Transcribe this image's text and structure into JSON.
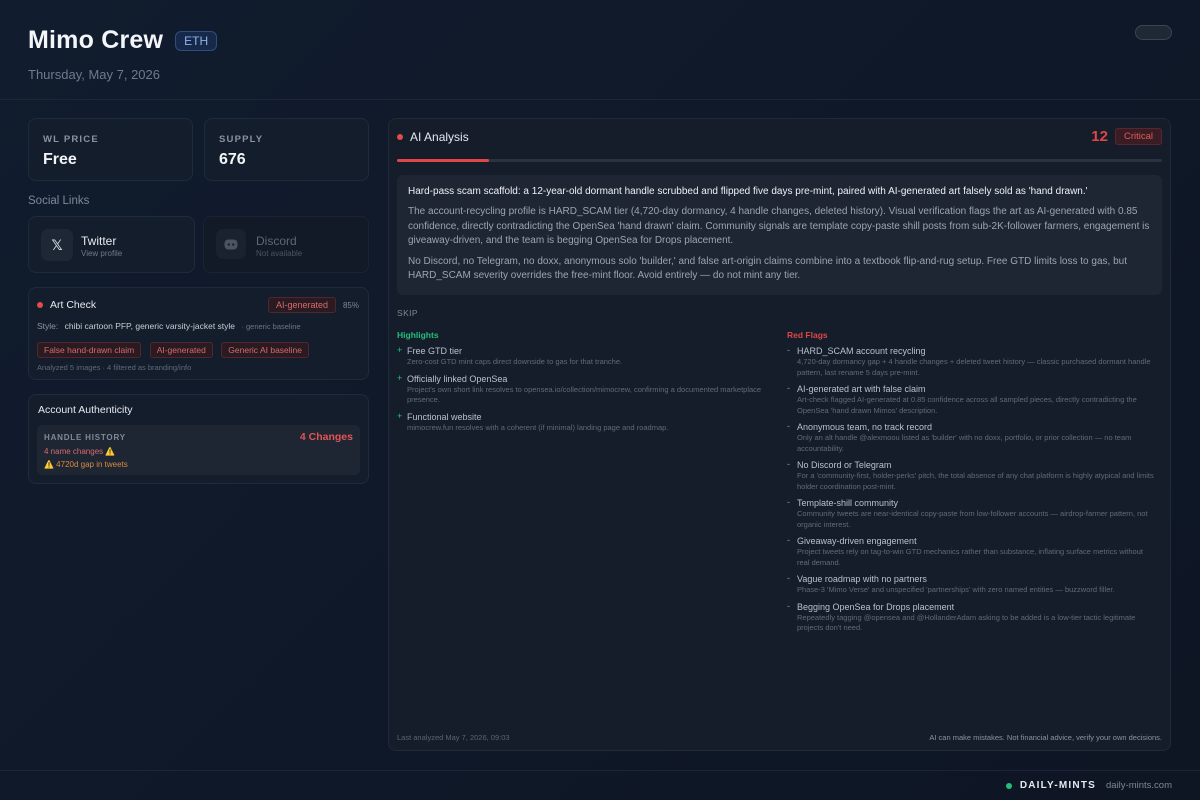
{
  "header": {
    "title": "Mimo Crew",
    "chain": "ETH",
    "date": "Thursday, May 7, 2026"
  },
  "stats": {
    "wl_price": {
      "label": "WL PRICE",
      "value": "Free"
    },
    "supply": {
      "label": "SUPPLY",
      "value": "676"
    }
  },
  "social": {
    "section_label": "Social Links",
    "twitter": {
      "name": "Twitter",
      "sub": "View profile",
      "icon": "x-logo-icon"
    },
    "discord": {
      "name": "Discord",
      "sub": "Not available",
      "icon": "discord-logo-icon"
    }
  },
  "art_check": {
    "title": "Art Check",
    "verdict": "AI-generated",
    "confidence": "85%",
    "style_label": "Style:",
    "style_value": "chibi cartoon PFP, generic varsity-jacket style",
    "style_note": "· generic baseline",
    "tags": [
      "False hand-drawn claim",
      "AI-generated",
      "Generic AI baseline"
    ],
    "footnote": "Analyzed 5 images · 4 filtered as branding/info"
  },
  "authenticity": {
    "title": "Account Authenticity",
    "handle_label": "HANDLE HISTORY",
    "changes": "4 Changes",
    "name_changes": "4 name changes ⚠️",
    "gap": "⚠️ 4720d gap in tweets"
  },
  "ai": {
    "title": "AI Analysis",
    "score": "12",
    "severity": "Critical",
    "progress": 0.12,
    "summary_head": "Hard-pass scam scaffold: a 12-year-old dormant handle scrubbed and flipped five days pre-mint, paired with AI-generated art falsely sold as 'hand drawn.'",
    "summary_p1": "The account-recycling profile is HARD_SCAM tier (4,720-day dormancy, 4 handle changes, deleted history). Visual verification flags the art as AI-generated with 0.85 confidence, directly contradicting the OpenSea 'hand drawn' claim. Community signals are template copy-paste shill posts from sub-2K-follower farmers, engagement is giveaway-driven, and the team is begging OpenSea for Drops placement.",
    "summary_p2": "No Discord, no Telegram, no doxx, anonymous solo 'builder,' and false art-origin claims combine into a textbook flip-and-rug setup. Free GTD limits loss to gas, but HARD_SCAM severity overrides the free-mint floor. Avoid entirely — do not mint any tier.",
    "verdict": "SKIP",
    "highlights_label": "Highlights",
    "highlights": [
      {
        "title": "Free GTD tier",
        "desc": "Zero-cost GTD mint caps direct downside to gas for that tranche."
      },
      {
        "title": "Officially linked OpenSea",
        "desc": "Project's own short link resolves to opensea.io/collection/mimocrew, confirming a documented marketplace presence."
      },
      {
        "title": "Functional website",
        "desc": "mimocrew.fun resolves with a coherent (if minimal) landing page and roadmap."
      }
    ],
    "redflags_label": "Red Flags",
    "redflags": [
      {
        "title": "HARD_SCAM account recycling",
        "desc": "4,720-day dormancy gap + 4 handle changes + deleted tweet history — classic purchased dormant handle pattern, last rename 5 days pre-mint."
      },
      {
        "title": "AI-generated art with false claim",
        "desc": "Art-check flagged AI-generated at 0.85 confidence across all sampled pieces, directly contradicting the OpenSea 'hand drawn Mimos' description."
      },
      {
        "title": "Anonymous team, no track record",
        "desc": "Only an alt handle @alexmoou listed as 'builder' with no doxx, portfolio, or prior collection — no team accountability."
      },
      {
        "title": "No Discord or Telegram",
        "desc": "For a 'community-first, holder-perks' pitch, the total absence of any chat platform is highly atypical and limits holder coordination post-mint."
      },
      {
        "title": "Template-shill community",
        "desc": "Community tweets are near-identical copy-paste from low-follower accounts — airdrop-farmer pattern, not organic interest."
      },
      {
        "title": "Giveaway-driven engagement",
        "desc": "Project tweets rely on tag-to-win GTD mechanics rather than substance, inflating surface metrics without real demand."
      },
      {
        "title": "Vague roadmap with no partners",
        "desc": "Phase-3 'Mimo Verse' and unspecified 'partnerships' with zero named entities — buzzword filler."
      },
      {
        "title": "Begging OpenSea for Drops placement",
        "desc": "Repeatedly tagging @opensea and @HollanderAdam asking to be added is a low-tier tactic legitimate projects don't need."
      }
    ],
    "last_analyzed": "Last analyzed May 7, 2026, 09:03",
    "disclaimer": "AI can make mistakes. Not financial advice, verify your own decisions."
  },
  "footer": {
    "brand": "DAILY-MINTS",
    "url": "daily-mints.com"
  },
  "colors": {
    "accent_red": "#e04646",
    "highlight_green": "#21c07a",
    "warning_orange": "#d98a3a",
    "chain_blue": "#8fb2ea"
  }
}
